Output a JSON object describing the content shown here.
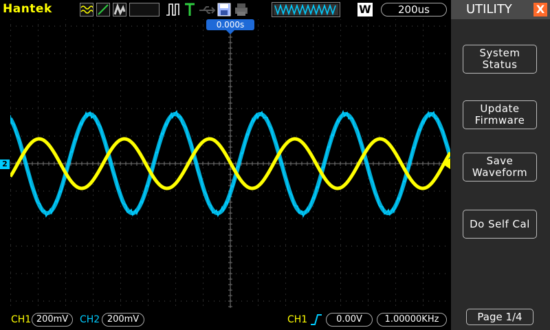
{
  "header": {
    "brand": "Hantek",
    "wave_indicator": "WWWWWWW",
    "memory_badge": "W",
    "timebase": "200us"
  },
  "trigger": {
    "position": "0.000s",
    "ch2_marker": "2"
  },
  "footer": {
    "ch1_label": "CH1",
    "ch1_scale": "200mV",
    "ch2_label": "CH2",
    "ch2_scale": "200mV",
    "trigger_source": "CH1",
    "trigger_level": "0.00V",
    "frequency": "1.00000KHz"
  },
  "sidebar": {
    "title": "UTILITY",
    "close": "X",
    "buttons": [
      {
        "label": "System\nStatus"
      },
      {
        "label": "Update\nFirmware"
      },
      {
        "label": "Save\nWaveform"
      },
      {
        "label": "Do Self Cal"
      }
    ],
    "page": "Page 1/4"
  },
  "colors": {
    "ch1": "#ffff00",
    "ch2": "#00ccff",
    "trigger_pos": "#1e6ad8",
    "close": "#ff6a2a"
  },
  "waveforms": {
    "ch1": {
      "period_divisions": 3.1,
      "amplitude_divisions": 0.9
    },
    "ch2": {
      "period_divisions": 3.1,
      "amplitude_divisions": 1.8
    }
  }
}
